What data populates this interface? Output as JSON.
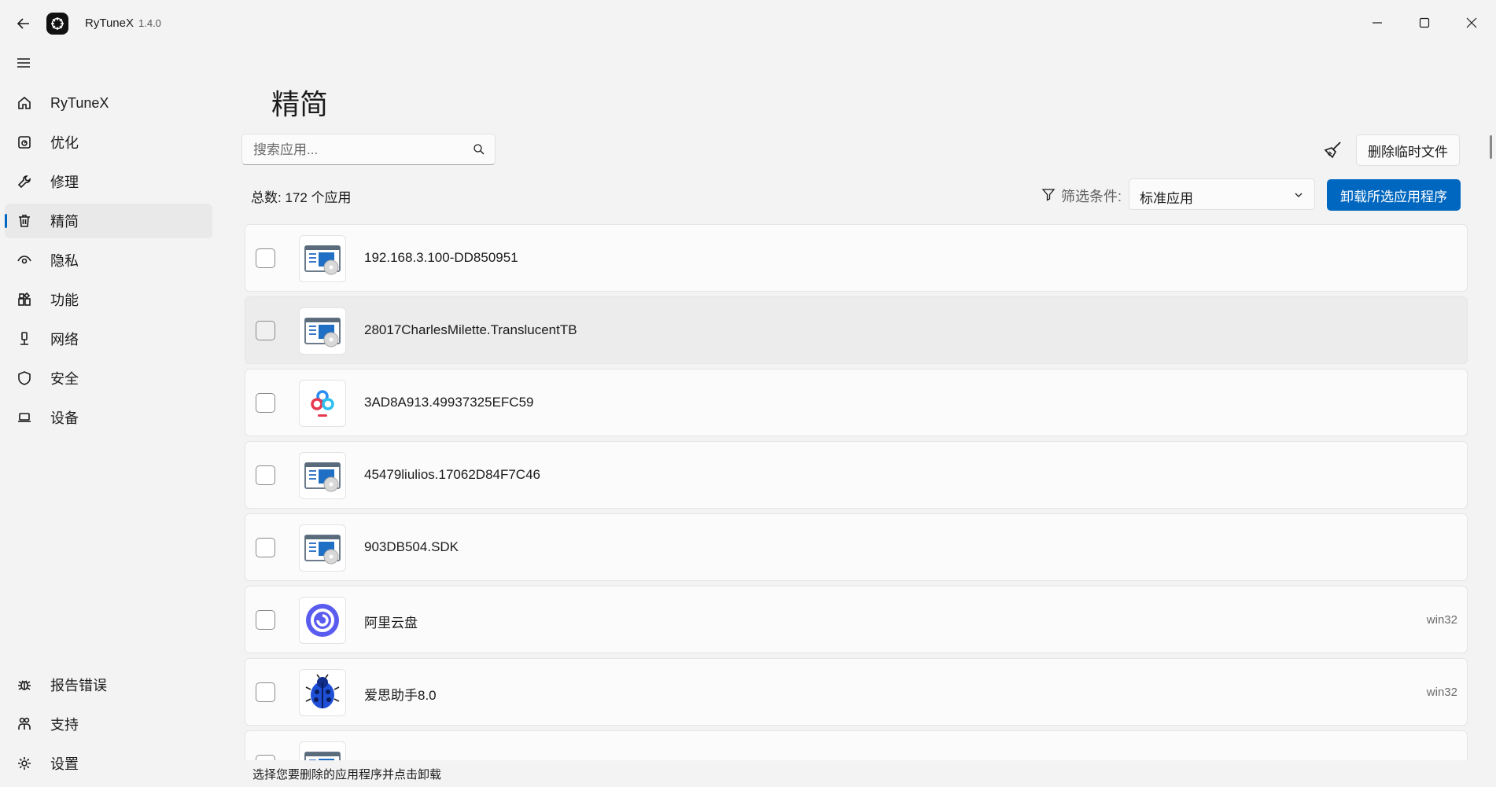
{
  "window": {
    "app_name": "RyTuneX",
    "version": "1.4.0"
  },
  "sidebar": {
    "items": [
      {
        "label": "RyTuneX",
        "icon": "home-icon"
      },
      {
        "label": "优化",
        "icon": "speed-icon"
      },
      {
        "label": "修理",
        "icon": "wrench-icon"
      },
      {
        "label": "精简",
        "icon": "trash-icon",
        "active": true
      },
      {
        "label": "隐私",
        "icon": "eye-icon"
      },
      {
        "label": "功能",
        "icon": "apps-icon"
      },
      {
        "label": "网络",
        "icon": "network-icon"
      },
      {
        "label": "安全",
        "icon": "shield-icon"
      },
      {
        "label": "设备",
        "icon": "laptop-icon"
      }
    ],
    "footer": [
      {
        "label": "报告错误",
        "icon": "bug-icon"
      },
      {
        "label": "支持",
        "icon": "support-icon"
      },
      {
        "label": "设置",
        "icon": "gear-icon"
      }
    ]
  },
  "main": {
    "title": "精简",
    "search_placeholder": "搜索应用...",
    "delete_temp_label": "删除临时文件",
    "total_label": "总数: 172 个应用",
    "filter_label": "筛选条件:",
    "filter_value": "标准应用",
    "uninstall_label": "卸载所选应用程序",
    "status_text": "选择您要删除的应用程序并点击卸载",
    "apps": [
      {
        "name": "192.168.3.100-DD850951",
        "type": "",
        "icon": "installer-icon"
      },
      {
        "name": "28017CharlesMilette.TranslucentTB",
        "type": "",
        "icon": "installer-icon"
      },
      {
        "name": "3AD8A913.49937325EFC59",
        "type": "",
        "icon": "baidu-netdisk-icon"
      },
      {
        "name": "45479liulios.17062D84F7C46",
        "type": "",
        "icon": "installer-icon"
      },
      {
        "name": "903DB504.SDK",
        "type": "",
        "icon": "installer-icon"
      },
      {
        "name": "阿里云盘",
        "type": "win32",
        "icon": "aliyun-drive-icon"
      },
      {
        "name": "爱思助手8.0",
        "type": "win32",
        "icon": "ladybug-icon"
      },
      {
        "name": "",
        "type": "",
        "icon": "installer-icon"
      }
    ]
  },
  "colors": {
    "accent": "#0067c0",
    "background": "#f3f3f3",
    "card": "#fbfbfb"
  }
}
